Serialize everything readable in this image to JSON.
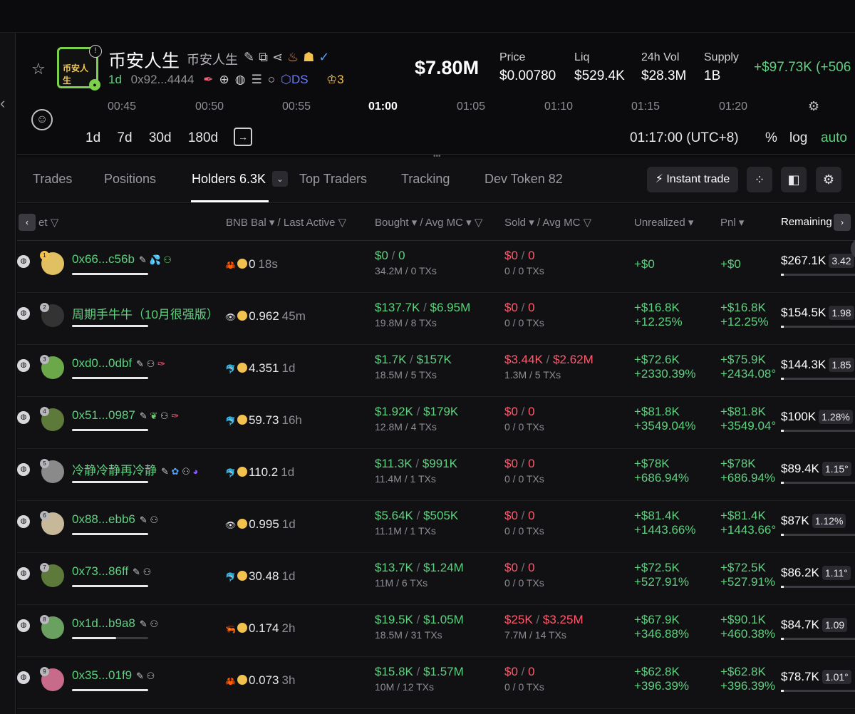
{
  "token": {
    "name": "币安人生",
    "symbol": "币安人生",
    "logo_text": "币安人生",
    "age": "1d",
    "address": "0x92...4444",
    "ds_label": "DS",
    "crown_count": "3"
  },
  "stats": {
    "market_cap": "$7.80M",
    "price_label": "Price",
    "price": "$0.00780",
    "liq_label": "Liq",
    "liq": "$529.4K",
    "vol_label": "24h Vol",
    "vol": "$28.3M",
    "supply_label": "Supply",
    "supply": "1B",
    "delta": "+$97.73K (+506"
  },
  "timeline": {
    "ticks": [
      "00:45",
      "00:50",
      "00:55",
      "01:00",
      "01:05",
      "01:10",
      "01:15",
      "01:20"
    ],
    "ranges": [
      "1d",
      "7d",
      "30d",
      "180d"
    ],
    "clock": "01:17:00 (UTC+8)",
    "percent": "%",
    "log": "log",
    "auto": "auto"
  },
  "tabs": {
    "trades": "Trades",
    "positions": "Positions",
    "holders": "Holders 6.3K",
    "top_traders": "Top Traders",
    "tracking": "Tracking",
    "dev_token": "Dev Token 82",
    "instant_trade": "Instant trade"
  },
  "columns": {
    "wallet": "et",
    "bnb_bal": "BNB Bal ▾ / Last Active",
    "bought": "Bought ▾ / Avg MC ▾",
    "sold": "Sold ▾ / Avg MC",
    "unrealized": "Unrealized ▾",
    "pnl": "Pnl ▾",
    "remaining": "Remaining"
  },
  "holders": [
    {
      "rank": "1",
      "name": "0x66...c56b",
      "bnb": "0",
      "active": "18s",
      "bought": "$0",
      "bought_mc": "0",
      "bought_sub": "34.2M / 0 TXs",
      "sold": "$0",
      "sold_mc": "0",
      "sold_sub": "0 / 0 TXs",
      "unreal": "+$0",
      "unreal_pct": "",
      "pnl": "+$0",
      "pnl_pct": "",
      "remaining": "$267.1K",
      "rem_pct": "3.42",
      "bar": 1.0
    },
    {
      "rank": "2",
      "name": "周期手牛牛（10月很强版）",
      "bnb": "0.962",
      "active": "45m",
      "bought": "$137.7K",
      "bought_mc": "$6.95M",
      "bought_sub": "19.8M / 8 TXs",
      "sold": "$0",
      "sold_mc": "0",
      "sold_sub": "0 / 0 TXs",
      "unreal": "+$16.8K",
      "unreal_pct": "+12.25%",
      "pnl": "+$16.8K",
      "pnl_pct": "+12.25%",
      "remaining": "$154.5K",
      "rem_pct": "1.98",
      "bar": 1.0
    },
    {
      "rank": "3",
      "name": "0xd0...0dbf",
      "bnb": "4.351",
      "active": "1d",
      "bought": "$1.7K",
      "bought_mc": "$157K",
      "bought_sub": "18.5M / 5 TXs",
      "sold": "$3.44K",
      "sold_mc": "$2.62M",
      "sold_sub": "1.3M / 5 TXs",
      "unreal": "+$72.6K",
      "unreal_pct": "+2330.39%",
      "pnl": "+$75.9K",
      "pnl_pct": "+2434.08°",
      "remaining": "$144.3K",
      "rem_pct": "1.85",
      "bar": 1.0
    },
    {
      "rank": "4",
      "name": "0x51...0987",
      "bnb": "59.73",
      "active": "16h",
      "bought": "$1.92K",
      "bought_mc": "$179K",
      "bought_sub": "12.8M / 4 TXs",
      "sold": "$0",
      "sold_mc": "0",
      "sold_sub": "0 / 0 TXs",
      "unreal": "+$81.8K",
      "unreal_pct": "+3549.04%",
      "pnl": "+$81.8K",
      "pnl_pct": "+3549.04°",
      "remaining": "$100K",
      "rem_pct": "1.28%",
      "bar": 1.0
    },
    {
      "rank": "5",
      "name": "冷静冷静再冷静",
      "bnb": "110.2",
      "active": "1d",
      "bought": "$11.3K",
      "bought_mc": "$991K",
      "bought_sub": "11.4M / 1 TXs",
      "sold": "$0",
      "sold_mc": "0",
      "sold_sub": "0 / 0 TXs",
      "unreal": "+$78K",
      "unreal_pct": "+686.94%",
      "pnl": "+$78K",
      "pnl_pct": "+686.94%",
      "remaining": "$89.4K",
      "rem_pct": "1.15°",
      "bar": 1.0
    },
    {
      "rank": "6",
      "name": "0x88...ebb6",
      "bnb": "0.995",
      "active": "1d",
      "bought": "$5.64K",
      "bought_mc": "$505K",
      "bought_sub": "11.1M / 1 TXs",
      "sold": "$0",
      "sold_mc": "0",
      "sold_sub": "0 / 0 TXs",
      "unreal": "+$81.4K",
      "unreal_pct": "+1443.66%",
      "pnl": "+$81.4K",
      "pnl_pct": "+1443.66°",
      "remaining": "$87K",
      "rem_pct": "1.12%",
      "bar": 1.0
    },
    {
      "rank": "7",
      "name": "0x73...86ff",
      "bnb": "30.48",
      "active": "1d",
      "bought": "$13.7K",
      "bought_mc": "$1.24M",
      "bought_sub": "11M / 6 TXs",
      "sold": "$0",
      "sold_mc": "0",
      "sold_sub": "0 / 0 TXs",
      "unreal": "+$72.5K",
      "unreal_pct": "+527.91%",
      "pnl": "+$72.5K",
      "pnl_pct": "+527.91%",
      "remaining": "$86.2K",
      "rem_pct": "1.11°",
      "bar": 1.0
    },
    {
      "rank": "8",
      "name": "0x1d...b9a8",
      "bnb": "0.174",
      "active": "2h",
      "bought": "$19.5K",
      "bought_mc": "$1.05M",
      "bought_sub": "18.5M / 31 TXs",
      "sold": "$25K",
      "sold_mc": "$3.25M",
      "sold_sub": "7.7M / 14 TXs",
      "unreal": "+$67.9K",
      "unreal_pct": "+346.88%",
      "pnl": "+$90.1K",
      "pnl_pct": "+460.38%",
      "remaining": "$84.7K",
      "rem_pct": "1.09",
      "bar": 0.58
    },
    {
      "rank": "9",
      "name": "0x35...01f9",
      "bnb": "0.073",
      "active": "3h",
      "bought": "$15.8K",
      "bought_mc": "$1.57M",
      "bought_sub": "10M / 12 TXs",
      "sold": "$0",
      "sold_mc": "0",
      "sold_sub": "0 / 0 TXs",
      "unreal": "+$62.8K",
      "unreal_pct": "+396.39%",
      "pnl": "+$62.8K",
      "pnl_pct": "+396.39%",
      "remaining": "$78.7K",
      "rem_pct": "1.01°",
      "bar": 1.0
    }
  ]
}
